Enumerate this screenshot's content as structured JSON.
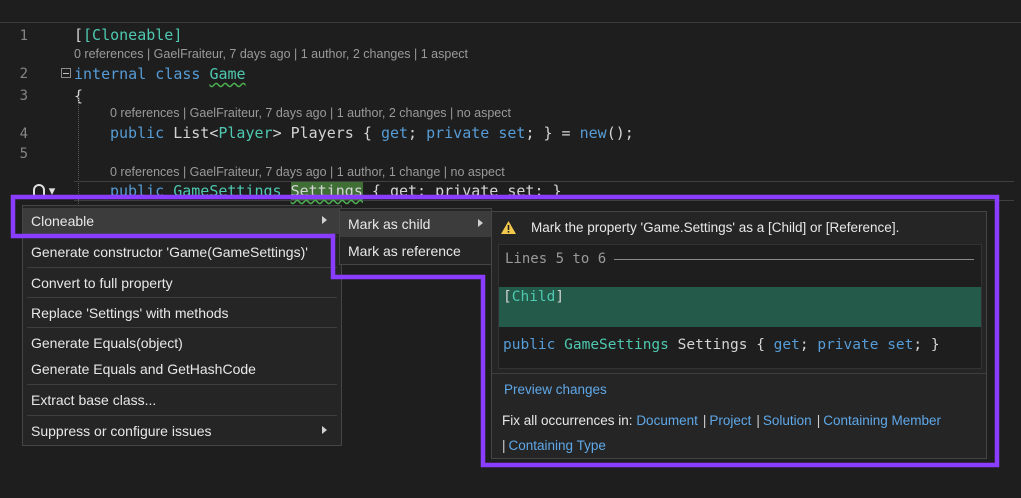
{
  "editor": {
    "line_numbers": [
      "1",
      "2",
      "3",
      "4",
      "5"
    ],
    "lines": {
      "l1": "[Cloneable]",
      "lens1": "0 references | GaelFraiteur, 7 days ago | 1 author, 2 changes | 1 aspect",
      "l2_kw": "internal class",
      "l2_name": "Game",
      "l3": "{",
      "lens2": "0 references | GaelFraiteur, 7 days ago | 1 author, 2 changes | no aspect",
      "l4_kw": "public",
      "l4_type": "List<Player>",
      "l4_name": "Players",
      "l4_rest1": "{",
      "l4_get": "get;",
      "l4_private": "private",
      "l4_set": "set;",
      "l4_rest2": "} =",
      "l4_new": "new",
      "l4_end": "();",
      "lens3": "0 references | GaelFraiteur, 7 days ago | 1 author, 1 change | no aspect",
      "l6_kw": "public",
      "l6_type": "GameSettings",
      "l6_name": "Settings",
      "l6_rest": "{ get; private set; }"
    }
  },
  "context_menu": {
    "items": [
      {
        "label": "Cloneable",
        "has_submenu": true
      },
      {
        "label": "Generate constructor 'Game(GameSettings)'"
      },
      {
        "label": "Convert to full property"
      },
      {
        "label": "Replace 'Settings' with methods"
      },
      {
        "label": "Generate Equals(object)"
      },
      {
        "label": "Generate Equals and GetHashCode"
      },
      {
        "label": "Extract base class..."
      },
      {
        "label": "Suppress or configure issues",
        "has_submenu": true
      }
    ]
  },
  "submenu": {
    "items": [
      {
        "label": "Mark as child"
      },
      {
        "label": "Mark as reference"
      }
    ]
  },
  "preview": {
    "message": "Mark the property 'Game.Settings' as a [Child] or [Reference].",
    "lines_header": "Lines 5 to 6",
    "added_open": "[",
    "added_attr": "Child",
    "added_close": "]",
    "code_kw": "public",
    "code_type": "GameSettings",
    "code_name": "Settings",
    "code_open": "{",
    "code_get": "get",
    "code_semi1": ";",
    "code_private": "private",
    "code_set": "set",
    "code_close": "; }",
    "preview_link": "Preview changes",
    "fix_all_label": "Fix all occurrences in:",
    "scopes": [
      "Document",
      "Project",
      "Solution",
      "Containing Member",
      "Containing Type"
    ]
  },
  "colors": {
    "outline": "#8b3dff",
    "keyword": "#569cd6",
    "type": "#4ec9b0",
    "link": "#5fa8e8"
  }
}
